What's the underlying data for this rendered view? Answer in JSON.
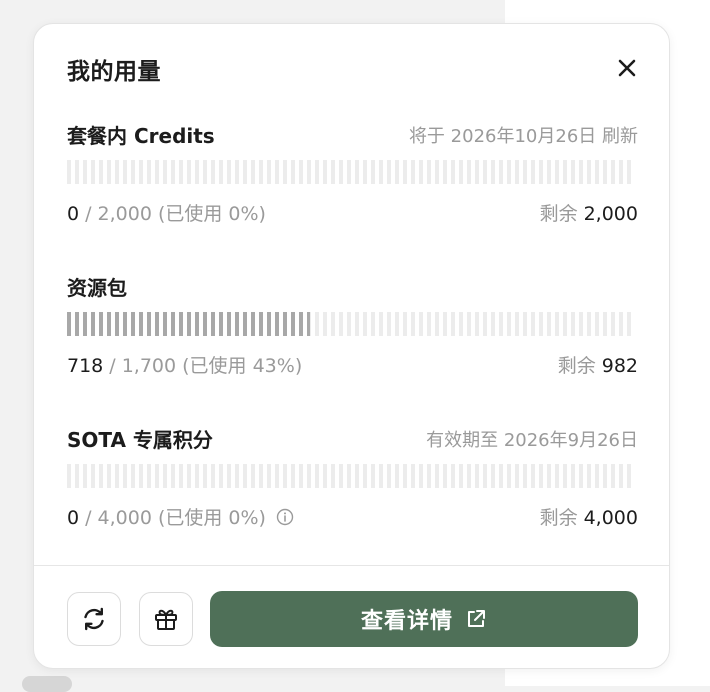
{
  "panel": {
    "title": "我的用量"
  },
  "sections": [
    {
      "title": "套餐内 Credits",
      "note": "将于 2026年10月26日 刷新",
      "used": "0",
      "total_text": "/ 2,000 (已使用 0%)",
      "used_fraction": 0,
      "remaining_label": "剩余",
      "remaining_value": "2,000"
    },
    {
      "title": "资源包",
      "note": "",
      "used": "718",
      "total_text": "/ 1,700 (已使用 43%)",
      "used_fraction": 0.43,
      "remaining_label": "剩余",
      "remaining_value": "982"
    },
    {
      "title": "SOTA 专属积分",
      "note": "有效期至 2026年9月26日",
      "used": "0",
      "total_text": "/ 4,000 (已使用 0%)",
      "used_fraction": 0,
      "remaining_label": "剩余",
      "remaining_value": "4,000",
      "has_info_icon": true
    }
  ],
  "footer": {
    "refresh_icon": "refresh-icon",
    "gift_icon": "gift-icon",
    "details_label": "查看详情",
    "details_icon": "external-link-icon",
    "accent_color": "#4f7058"
  }
}
